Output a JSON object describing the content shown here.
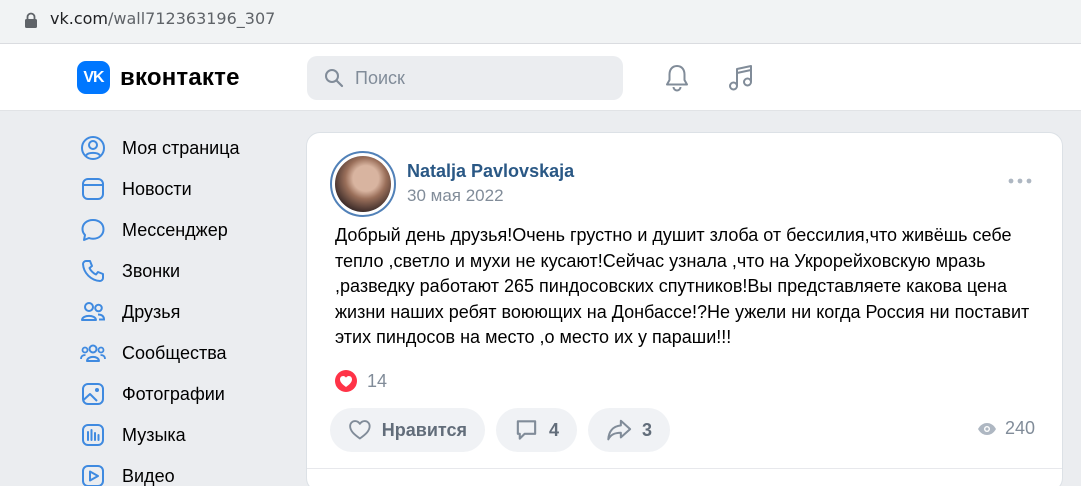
{
  "browser": {
    "url_host": "vk.com",
    "url_path": "/wall712363196_307"
  },
  "header": {
    "logo_text": "вконтакте",
    "search_placeholder": "Поиск"
  },
  "sidebar": {
    "items": [
      {
        "label": "Моя страница",
        "icon": "profile-icon"
      },
      {
        "label": "Новости",
        "icon": "news-icon"
      },
      {
        "label": "Мессенджер",
        "icon": "messenger-icon"
      },
      {
        "label": "Звонки",
        "icon": "phone-icon"
      },
      {
        "label": "Друзья",
        "icon": "friends-icon"
      },
      {
        "label": "Сообщества",
        "icon": "communities-icon"
      },
      {
        "label": "Фотографии",
        "icon": "photos-icon"
      },
      {
        "label": "Музыка",
        "icon": "music-icon"
      },
      {
        "label": "Видео",
        "icon": "video-icon"
      }
    ]
  },
  "post": {
    "author": "Natalja Pavlovskaja",
    "date": "30 мая 2022",
    "text": "Добрый день друзья!Очень грустно и душит злоба от бессилия,что живёшь себе тепло ,светло и мухи не кусают!Сейчас узнала ,что на Укрорейховскую мразь ,разведку работают 265 пиндосовских спутников!Вы представляете какова цена жизни наших ребят воюющих на Донбассе!?Не ужели ни когда Россия ни поставит этих пиндосов на место ,о место их у параши!!!",
    "likes_count": "14",
    "like_label": "Нравится",
    "comments_count": "4",
    "shares_count": "3",
    "views_count": "240"
  },
  "colors": {
    "accent": "#0077ff",
    "link": "#2a5885",
    "nav_icon": "#3f8ae0",
    "heart": "#ff3347"
  }
}
